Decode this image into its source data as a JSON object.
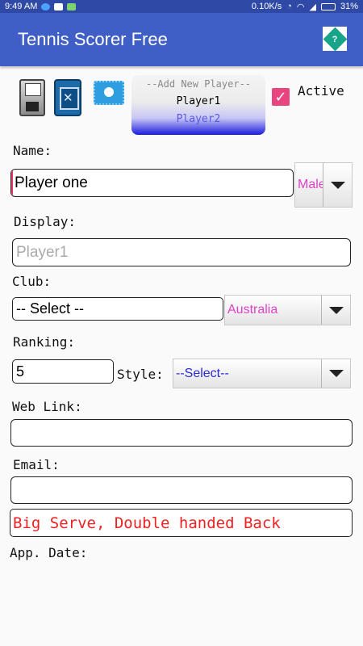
{
  "status_bar": {
    "time": "9:49 AM",
    "network_speed": "0.10K/s",
    "battery": "31%",
    "notification_icons": [
      "messenger-icon",
      "gmail-icon",
      "store-icon"
    ],
    "system_icons": [
      "alarm-icon",
      "wifi-icon",
      "signal-icon",
      "battery-icon"
    ]
  },
  "app_bar": {
    "title": "Tennis Scorer Free",
    "help_label": "?"
  },
  "toolbar": {
    "icons": [
      "save-icon",
      "clear-icon",
      "add-photo-icon"
    ]
  },
  "player_picker": {
    "items": [
      "--Add New Player--",
      "Player1",
      "Player2"
    ]
  },
  "active": {
    "label": "Active",
    "checked": true,
    "check_glyph": "✓"
  },
  "form": {
    "name_label": "Name:",
    "name_value": "Player one",
    "gender_value": "Male",
    "display_label": "Display:",
    "display_placeholder": "Player1",
    "club_label": "Club:",
    "club_value": "-- Select --",
    "country_value": "Australia",
    "ranking_label": "Ranking:",
    "ranking_value": "5",
    "style_label": "Style:",
    "style_value": "--Select--",
    "weblink_label": "Web Link:",
    "weblink_value": "",
    "email_label": "Email:",
    "email_value": "",
    "notes_value": "Big Serve, Double handed Back",
    "app_date_label": "App. Date:"
  },
  "colors": {
    "status_bar": "#2f4aa6",
    "app_bar": "#3f5fc6",
    "spinner_text_pink": "#e040c8",
    "spinner_text_blue": "#2a2ad8",
    "notes_text": "#e22222",
    "checkbox": "#e8447e"
  }
}
